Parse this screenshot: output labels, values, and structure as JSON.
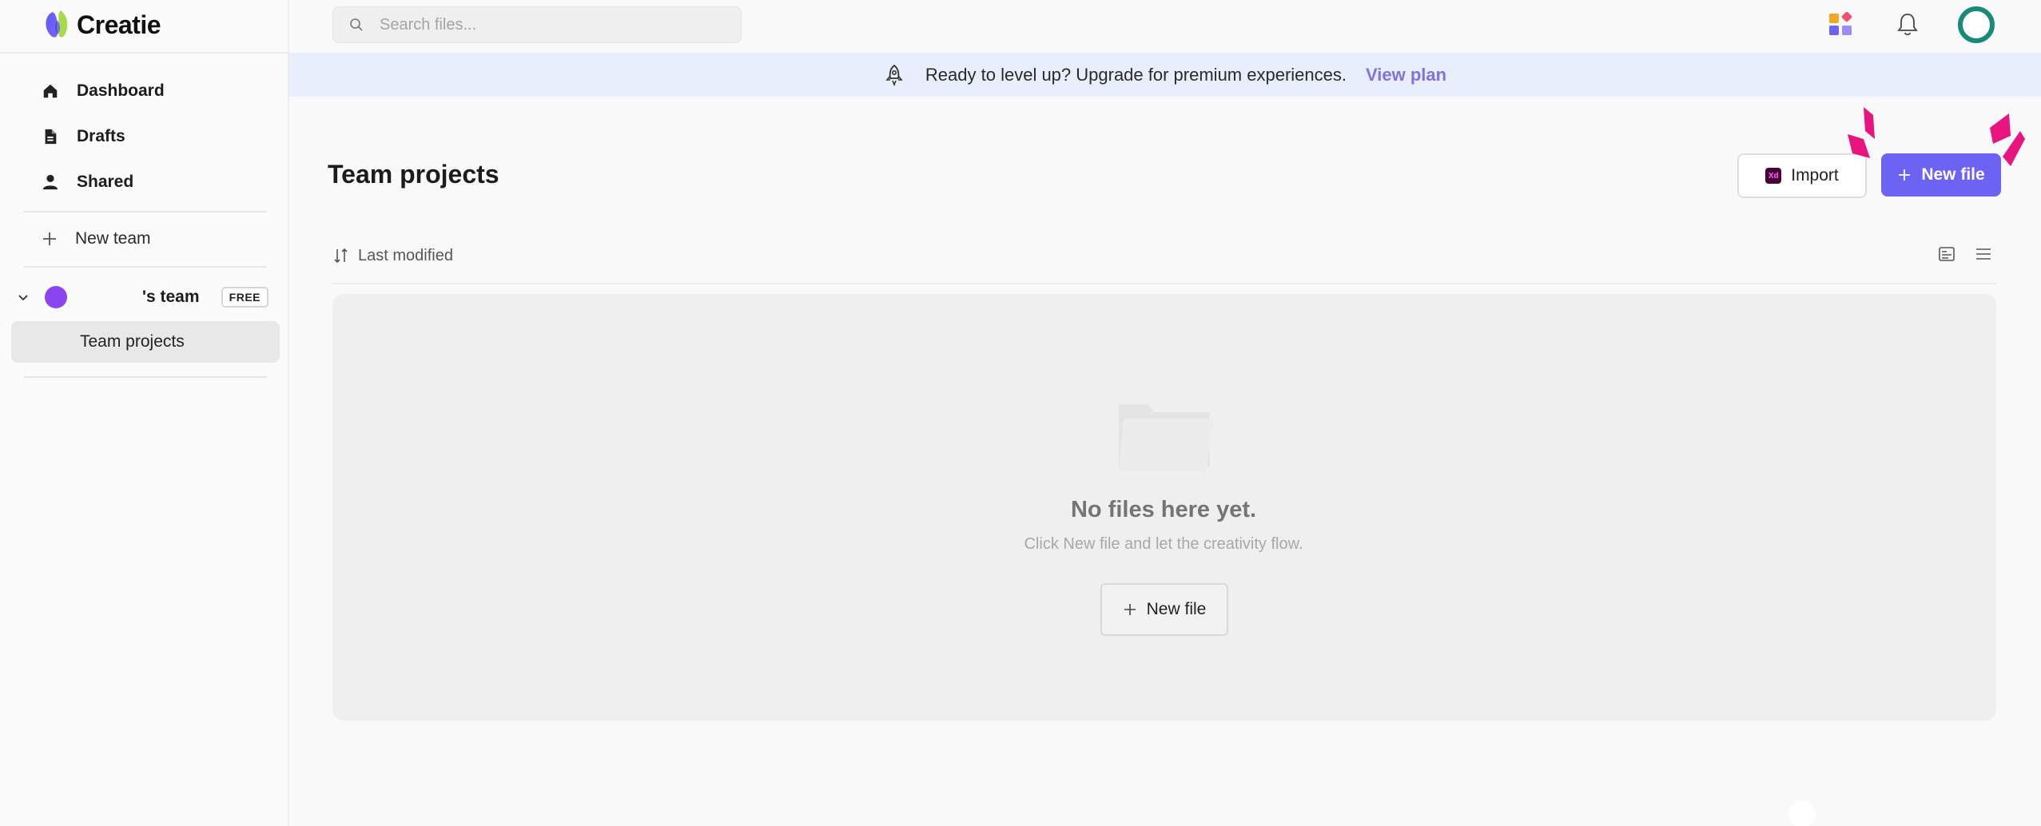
{
  "app": {
    "name": "Creatie"
  },
  "search": {
    "placeholder": "Search files..."
  },
  "sidebar": {
    "items": [
      {
        "label": "Dashboard",
        "icon": "home-icon"
      },
      {
        "label": "Drafts",
        "icon": "file-icon"
      },
      {
        "label": "Shared",
        "icon": "person-icon"
      }
    ],
    "new_team_label": "New team",
    "team": {
      "name_suffix": "'s team",
      "badge": "FREE",
      "avatar_color": "#8b45f0"
    },
    "team_projects_label": "Team projects"
  },
  "topbar": {
    "icons": [
      "apps-icon",
      "bell-icon",
      "avatar"
    ],
    "avatar_color": "#1a8a78"
  },
  "banner": {
    "text": "Ready to level up? Upgrade for premium experiences.",
    "link": "View plan",
    "background": "#e9eefc",
    "link_color": "#7f73df"
  },
  "main": {
    "title": "Team projects",
    "import_label": "Import",
    "new_file_label": "New file",
    "sort_label": "Last modified",
    "accent": "#6c62f4",
    "empty": {
      "title": "No files here yet.",
      "subtitle": "Click New file and let the creativity flow.",
      "button_label": "New file"
    }
  }
}
